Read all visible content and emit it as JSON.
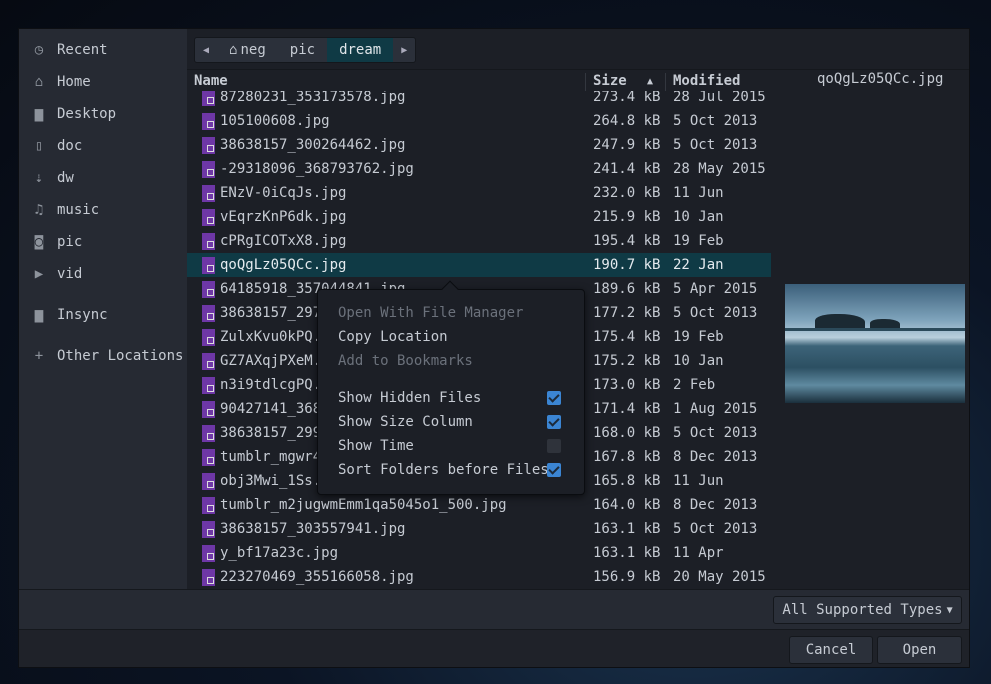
{
  "sidebar": {
    "items": [
      {
        "label": "Recent",
        "icon": "clock-icon"
      },
      {
        "label": "Home",
        "icon": "home-icon"
      },
      {
        "label": "Desktop",
        "icon": "folder-icon"
      },
      {
        "label": "doc",
        "icon": "document-icon"
      },
      {
        "label": "dw",
        "icon": "download-icon"
      },
      {
        "label": "music",
        "icon": "music-icon"
      },
      {
        "label": "pic",
        "icon": "camera-icon"
      },
      {
        "label": "vid",
        "icon": "video-icon"
      },
      {
        "label": "Insync",
        "icon": "folder-icon"
      },
      {
        "label": "Other Locations",
        "icon": "plus-icon"
      }
    ]
  },
  "pathbar": {
    "segments": [
      "neg",
      "pic",
      "dream"
    ],
    "current": "dream"
  },
  "columns": {
    "name": "Name",
    "size": "Size",
    "modified": "Modified",
    "sort": "ascending"
  },
  "files": [
    {
      "name": "87280231_353173578.jpg",
      "size": "273.4 kB",
      "modified": "28 Jul 2015"
    },
    {
      "name": "105100608.jpg",
      "size": "264.8 kB",
      "modified": "5 Oct 2013"
    },
    {
      "name": "38638157_300264462.jpg",
      "size": "247.9 kB",
      "modified": "5 Oct 2013"
    },
    {
      "name": "-29318096_368793762.jpg",
      "size": "241.4 kB",
      "modified": "28 May 2015"
    },
    {
      "name": "ENzV-0iCqJs.jpg",
      "size": "232.0 kB",
      "modified": "11 Jun"
    },
    {
      "name": "vEqrzKnP6dk.jpg",
      "size": "215.9 kB",
      "modified": "10 Jan"
    },
    {
      "name": "cPRgICOTxX8.jpg",
      "size": "195.4 kB",
      "modified": "19 Feb"
    },
    {
      "name": "qoQgLz05QCc.jpg",
      "size": "190.7 kB",
      "modified": "22 Jan",
      "selected": true
    },
    {
      "name": "64185918_357044841.jpg",
      "size": "189.6 kB",
      "modified": "5 Apr 2015"
    },
    {
      "name": "38638157_297",
      "size": "177.2 kB",
      "modified": "5 Oct 2013"
    },
    {
      "name": "ZulxKvu0kPQ.",
      "size": "175.4 kB",
      "modified": "19 Feb"
    },
    {
      "name": "GZ7AXqjPXeM.",
      "size": "175.2 kB",
      "modified": "10 Jan"
    },
    {
      "name": "n3i9tdlcgPQ.",
      "size": "173.0 kB",
      "modified": "2 Feb"
    },
    {
      "name": "90427141_368",
      "size": "171.4 kB",
      "modified": "1 Aug 2015"
    },
    {
      "name": "38638157_299",
      "size": "168.0 kB",
      "modified": "5 Oct 2013"
    },
    {
      "name": "tumblr_mgwr4",
      "size": "167.8 kB",
      "modified": "8 Dec 2013"
    },
    {
      "name": "obj3Mwi_1Ss.",
      "size": "165.8 kB",
      "modified": "11 Jun"
    },
    {
      "name": "tumblr_m2jugwmEmm1qa5045o1_500.jpg",
      "size": "164.0 kB",
      "modified": "8 Dec 2013"
    },
    {
      "name": "38638157_303557941.jpg",
      "size": "163.1 kB",
      "modified": "5 Oct 2013"
    },
    {
      "name": "y_bf17a23c.jpg",
      "size": "163.1 kB",
      "modified": "11 Apr"
    },
    {
      "name": "223270469_355166058.jpg",
      "size": "156.9 kB",
      "modified": "20 May 2015"
    }
  ],
  "preview": {
    "filename": "qoQgLz05QCc.jpg"
  },
  "context_menu": {
    "items": [
      {
        "label": "Open With File Manager",
        "enabled": false
      },
      {
        "label": "Copy Location",
        "enabled": true
      },
      {
        "label": "Add to Bookmarks",
        "enabled": false
      }
    ],
    "toggles": [
      {
        "label": "Show Hidden Files",
        "checked": true
      },
      {
        "label": "Show Size Column",
        "checked": true
      },
      {
        "label": "Show Time",
        "checked": false
      },
      {
        "label": "Sort Folders before Files",
        "checked": true
      }
    ]
  },
  "filter": {
    "selected": "All Supported Types"
  },
  "buttons": {
    "cancel": "Cancel",
    "open": "Open"
  },
  "colors": {
    "accent": "#0f3a45",
    "file_icon": "#6e37a6",
    "checkbox": "#3b85d3"
  }
}
